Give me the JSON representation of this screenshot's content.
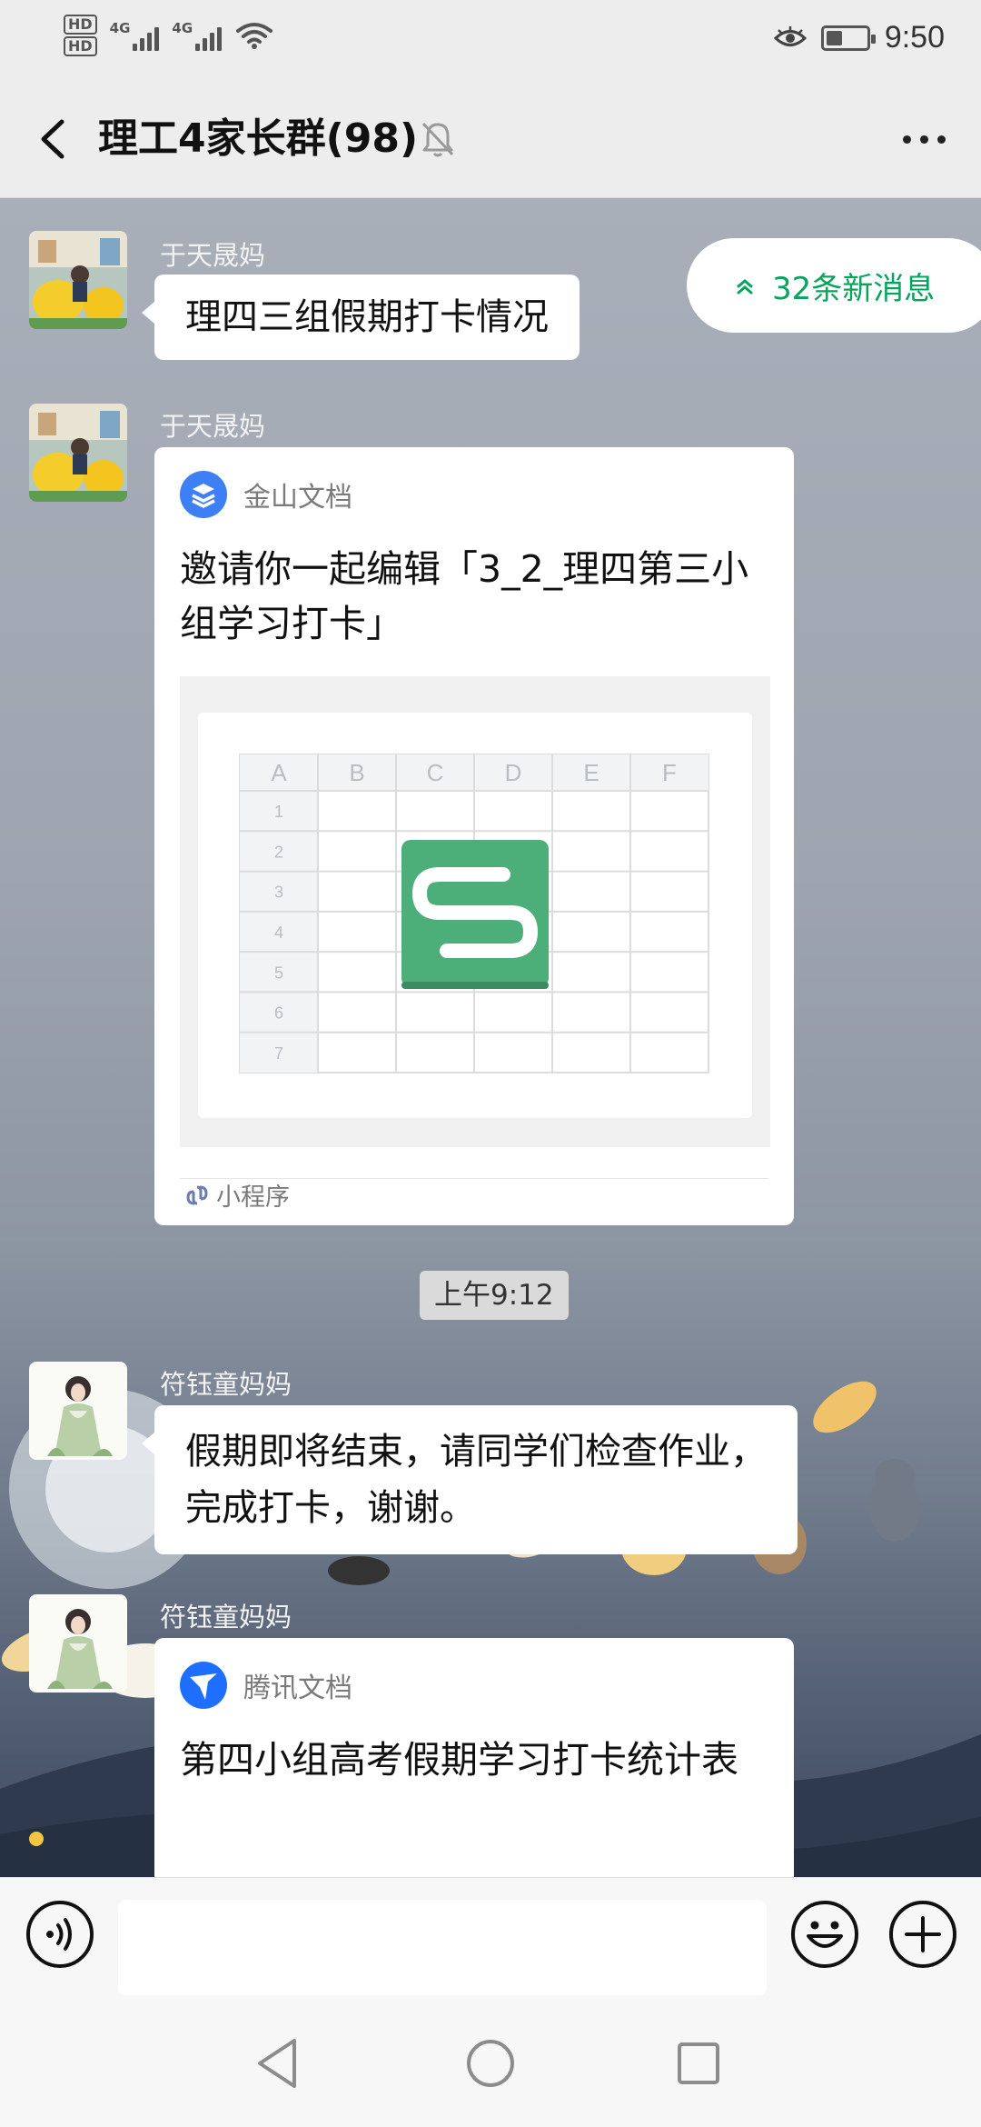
{
  "status_bar": {
    "hd1": "HD",
    "hd2": "HD",
    "net1": "4G",
    "net2": "4G",
    "time": "9:50",
    "battery_level": 0.4,
    "icons": [
      "signal-icon",
      "wifi-icon",
      "eye-icon",
      "battery-icon"
    ]
  },
  "header": {
    "title": "理工4家长群(98)",
    "back_icon": "chevron-left-icon",
    "mute_icon": "bell-off-icon",
    "more_icon": "more-dots-icon"
  },
  "new_messages": {
    "label": "32条新消息",
    "color": "#07a45e"
  },
  "messages": [
    {
      "sender": "于天晟妈",
      "type": "text",
      "text": "理四三组假期打卡情况"
    },
    {
      "sender": "于天晟妈",
      "type": "mini-program-card",
      "app": "金山文档",
      "title": "邀请你一起编辑「3_2_理四第三小组学习打卡」",
      "footer": "小程序",
      "sheet_columns": [
        "A",
        "B",
        "C",
        "D",
        "E",
        "F"
      ],
      "sheet_rows": [
        "1",
        "2",
        "3",
        "4",
        "5",
        "6",
        "7"
      ]
    },
    {
      "type": "time",
      "text": "上午9:12"
    },
    {
      "sender": "符钰童妈妈",
      "type": "text",
      "text": "假期即将结束，请同学们检查作业，完成打卡，谢谢。"
    },
    {
      "sender": "符钰童妈妈",
      "type": "mini-program-card",
      "app": "腾讯文档",
      "title": "第四小组高考假期学习打卡统计表"
    }
  ],
  "input": {
    "value": "",
    "placeholder": "",
    "voice_icon": "voice-icon",
    "emoji_icon": "emoji-icon",
    "add_icon": "plus-icon"
  },
  "colors": {
    "wps_green": "#4caf7a",
    "wps_blue": "#3d7ff5",
    "tencent_blue": "#1e6fff"
  }
}
